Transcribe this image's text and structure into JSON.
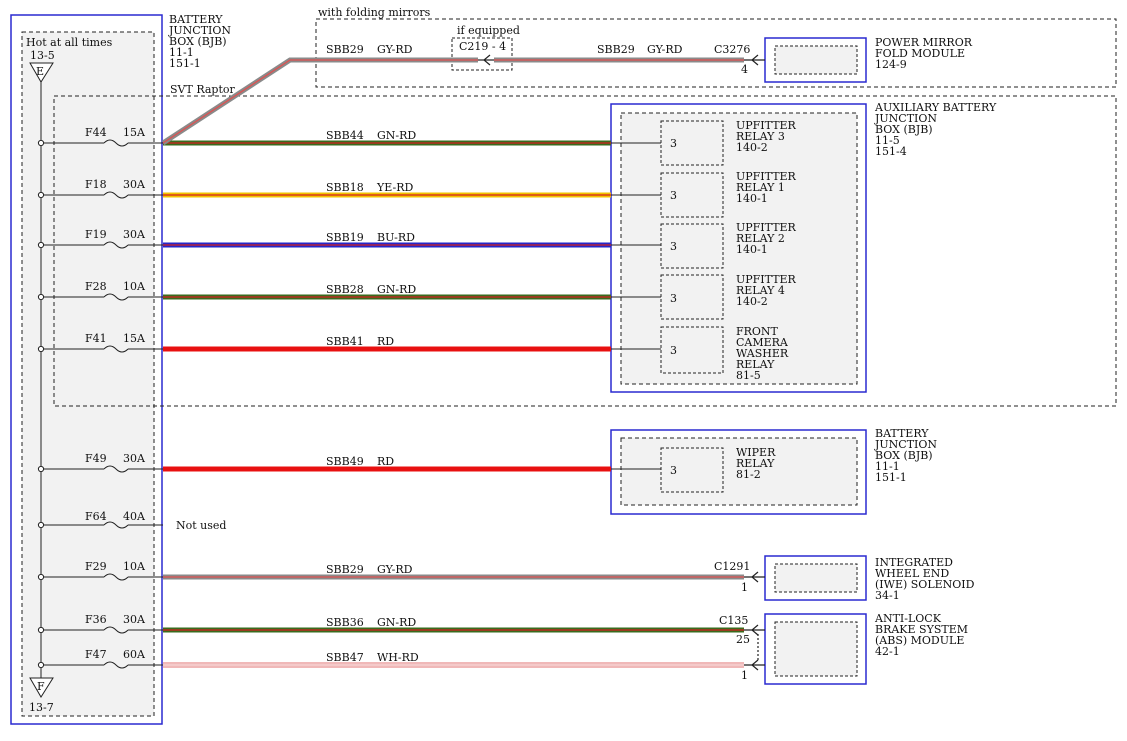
{
  "bjb": {
    "title_lines": [
      "BATTERY",
      "JUNCTION",
      "BOX (BJB)",
      "11-1",
      "151-1"
    ],
    "hot_text": "Hot at all times",
    "top_ref": "13-5",
    "top_letter": "E",
    "bottom_letter": "F",
    "bottom_ref": "13-7"
  },
  "folding": {
    "label": "with folding mirrors",
    "if_equipped": "if equipped",
    "connector": "C219 - 4",
    "left_circuit": "SBB29",
    "left_color": "GY-RD",
    "right_circuit": "SBB29",
    "right_color": "GY-RD",
    "end_connector": "C3276",
    "end_pin": "4",
    "module_lines": [
      "POWER MIRROR",
      "FOLD MODULE",
      "124-9"
    ]
  },
  "svt": {
    "label": "SVT Raptor"
  },
  "aux_bjb": {
    "title_lines": [
      "AUXILIARY BATTERY",
      "JUNCTION",
      "BOX (BJB)",
      "11-5",
      "151-4"
    ],
    "relays": [
      {
        "pin": "3",
        "lines": [
          "UPFITTER",
          "RELAY 3",
          "140-2"
        ]
      },
      {
        "pin": "3",
        "lines": [
          "UPFITTER",
          "RELAY 1",
          "140-1"
        ]
      },
      {
        "pin": "3",
        "lines": [
          "UPFITTER",
          "RELAY 2",
          "140-1"
        ]
      },
      {
        "pin": "3",
        "lines": [
          "UPFITTER",
          "RELAY 4",
          "140-2"
        ]
      },
      {
        "pin": "3",
        "lines": [
          "FRONT",
          "CAMERA",
          "WASHER",
          "RELAY",
          "81-5"
        ]
      }
    ]
  },
  "bjb2": {
    "title_lines": [
      "BATTERY",
      "JUNCTION",
      "BOX (BJB)",
      "11-1",
      "151-1"
    ],
    "relay": {
      "pin": "3",
      "lines": [
        "WIPER",
        "RELAY",
        "81-2"
      ]
    }
  },
  "fuses": [
    {
      "id": "F44",
      "amps": "15A",
      "circuit": "SBB44",
      "color": "GN-RD",
      "main": "#3a6b1e",
      "stripe": "#d42020"
    },
    {
      "id": "F18",
      "amps": "30A",
      "circuit": "SBB18",
      "color": "YE-RD",
      "main": "#f2c200",
      "stripe": "#d42020"
    },
    {
      "id": "F19",
      "amps": "30A",
      "circuit": "SBB19",
      "color": "BU-RD",
      "main": "#2626c8",
      "stripe": "#d42020"
    },
    {
      "id": "F28",
      "amps": "10A",
      "circuit": "SBB28",
      "color": "GN-RD",
      "main": "#3a6b1e",
      "stripe": "#d42020"
    },
    {
      "id": "F41",
      "amps": "15A",
      "circuit": "SBB41",
      "color": "RD",
      "main": "#e81010",
      "stripe": "#e81010"
    },
    {
      "id": "F49",
      "amps": "30A",
      "circuit": "SBB49",
      "color": "RD",
      "main": "#e81010",
      "stripe": "#e81010"
    },
    {
      "id": "F64",
      "amps": "40A",
      "not_used": "Not used"
    },
    {
      "id": "F29",
      "amps": "10A",
      "circuit": "SBB29",
      "color": "GY-RD",
      "main": "#8a8a8a",
      "stripe": "#e05050"
    },
    {
      "id": "F36",
      "amps": "30A",
      "circuit": "SBB36",
      "color": "GN-RD",
      "main": "#3a6b1e",
      "stripe": "#d42020"
    },
    {
      "id": "F47",
      "amps": "60A",
      "circuit": "SBB47",
      "color": "WH-RD",
      "main": "#ffffff",
      "stripe": "#e07070"
    }
  ],
  "iwe": {
    "connector": "C1291",
    "pin": "1",
    "module_lines": [
      "INTEGRATED",
      "WHEEL END",
      "(IWE) SOLENOID",
      "34-1"
    ]
  },
  "abs": {
    "connector": "C135",
    "pin_top": "25",
    "pin_bottom": "1",
    "module_lines": [
      "ANTI-LOCK",
      "BRAKE SYSTEM",
      "(ABS) MODULE",
      "42-1"
    ]
  }
}
